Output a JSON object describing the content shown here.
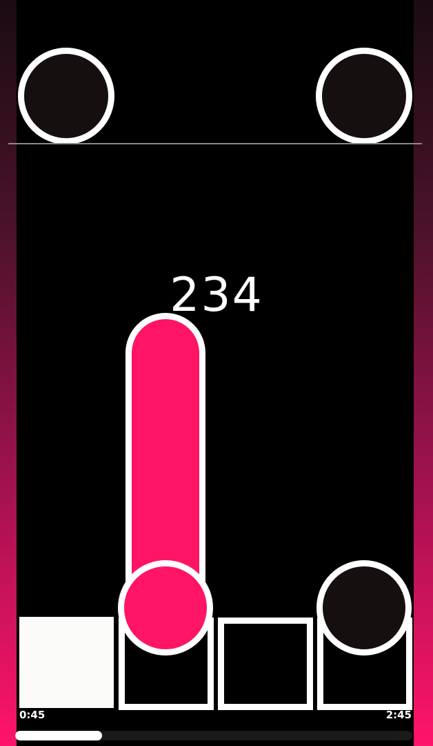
{
  "game": {
    "score": "234",
    "accent_color": "#ff1466",
    "lanes": 4
  },
  "playback": {
    "elapsed": "0:45",
    "total": "2:45",
    "progress_fraction": 0.2182
  }
}
